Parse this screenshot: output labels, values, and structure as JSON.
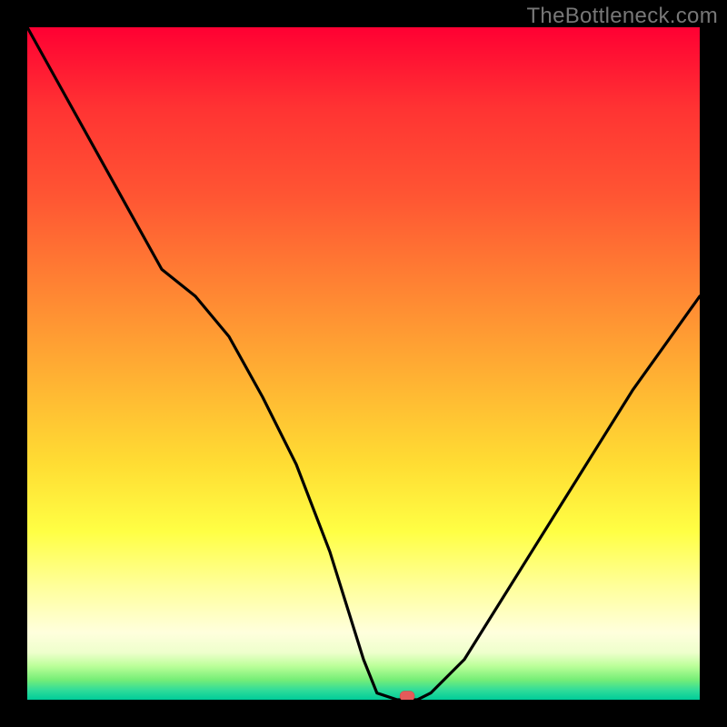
{
  "watermark": "TheBottleneck.com",
  "colors": {
    "background": "#000000",
    "gradient_top": "#ff0033",
    "gradient_bottom": "#00cc99",
    "curve": "#000000",
    "marker": "#e55a5a"
  },
  "chart_data": {
    "type": "line",
    "title": "",
    "xlabel": "",
    "ylabel": "",
    "xlim": [
      0,
      100
    ],
    "ylim": [
      0,
      100
    ],
    "series": [
      {
        "name": "bottleneck-curve",
        "x": [
          0,
          5,
          10,
          15,
          20,
          25,
          30,
          35,
          40,
          45,
          50,
          52,
          55,
          58,
          60,
          65,
          70,
          75,
          80,
          85,
          90,
          95,
          100
        ],
        "y": [
          100,
          91,
          82,
          73,
          64,
          60,
          54,
          45,
          35,
          22,
          6,
          1,
          0,
          0,
          1,
          6,
          14,
          22,
          30,
          38,
          46,
          53,
          60
        ]
      }
    ],
    "marker": {
      "x": 56.5,
      "y": 0,
      "label": ""
    },
    "grid": false,
    "legend": false
  }
}
